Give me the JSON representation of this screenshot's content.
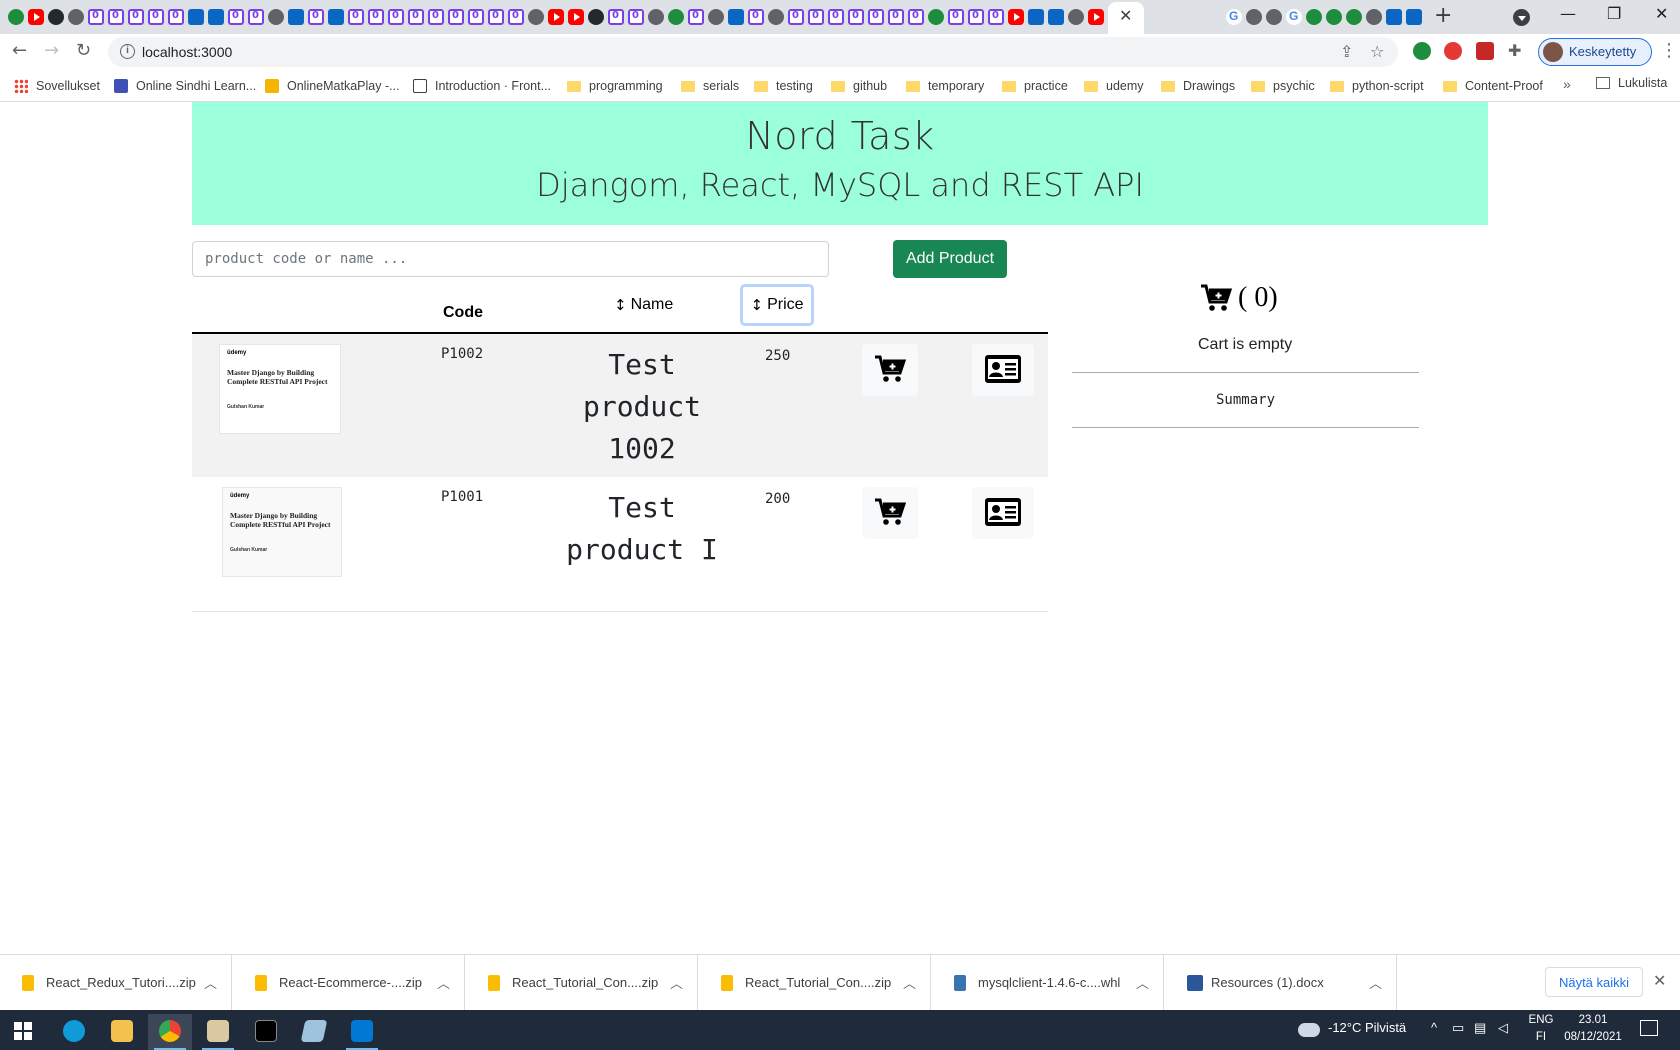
{
  "browser": {
    "url": "localhost:3000",
    "profile_label": "Keskeytetty",
    "bookmarks": [
      {
        "label": "Sovellukset",
        "icon": "apps-icon"
      },
      {
        "label": "Online Sindhi Learn...",
        "icon": "site-icon"
      },
      {
        "label": "OnlineMatkaPlay -...",
        "icon": "site-icon"
      },
      {
        "label": "Introduction · Front...",
        "icon": "book-icon"
      },
      {
        "label": "programming",
        "icon": "folder-icon"
      },
      {
        "label": "serials",
        "icon": "folder-icon"
      },
      {
        "label": "testing",
        "icon": "folder-icon"
      },
      {
        "label": "github",
        "icon": "folder-icon"
      },
      {
        "label": "temporary",
        "icon": "folder-icon"
      },
      {
        "label": "practice",
        "icon": "folder-icon"
      },
      {
        "label": "udemy",
        "icon": "folder-icon"
      },
      {
        "label": "Drawings",
        "icon": "folder-icon"
      },
      {
        "label": "psychic",
        "icon": "folder-icon"
      },
      {
        "label": "python-script",
        "icon": "folder-icon"
      },
      {
        "label": "Content-Proof",
        "icon": "folder-icon"
      }
    ],
    "reading_list_label": "Lukulista",
    "more_label": "»"
  },
  "app": {
    "title": "Nord Task",
    "subtitle": "Djangom, React, MySQL and REST API",
    "search_placeholder": "product code or name ...",
    "add_product_label": "Add Product",
    "columns": {
      "code": "Code",
      "name": "Name",
      "price": "Price"
    },
    "products": [
      {
        "code": "P1002",
        "name": "Test product 1002",
        "price": "250",
        "thumbnail": {
          "logo": "ûdemy",
          "course": "Master Django by Building Complete RESTful API Project",
          "author": "Gulshan Kumar"
        }
      },
      {
        "code": "P1001",
        "name": "Test product I",
        "price": "200",
        "thumbnail": {
          "logo": "ûdemy",
          "course": "Master Django by Building Complete RESTful API Project",
          "author": "Gulshan Kumar"
        }
      }
    ],
    "cart": {
      "count_label": "( 0)",
      "empty_label": "Cart is empty",
      "summary_label": "Summary"
    },
    "colors": {
      "hero_bg": "#9cffdc",
      "add_button": "#198754"
    }
  },
  "downloads": {
    "items": [
      {
        "name": "React_Redux_Tutori....zip",
        "icon": "zip-icon"
      },
      {
        "name": "React-Ecommerce-....zip",
        "icon": "zip-icon"
      },
      {
        "name": "React_Tutorial_Con....zip",
        "icon": "zip-icon"
      },
      {
        "name": "React_Tutorial_Con....zip",
        "icon": "zip-icon"
      },
      {
        "name": "mysqlclient-1.4.6-c....whl",
        "icon": "python-icon"
      },
      {
        "name": "Resources (1).docx",
        "icon": "word-icon"
      }
    ],
    "show_all_label": "Näytä kaikki"
  },
  "taskbar": {
    "weather": "-12°C Pilvistä",
    "lang_top": "ENG",
    "lang_bottom": "FI",
    "time": "23.01",
    "date": "08/12/2021"
  }
}
